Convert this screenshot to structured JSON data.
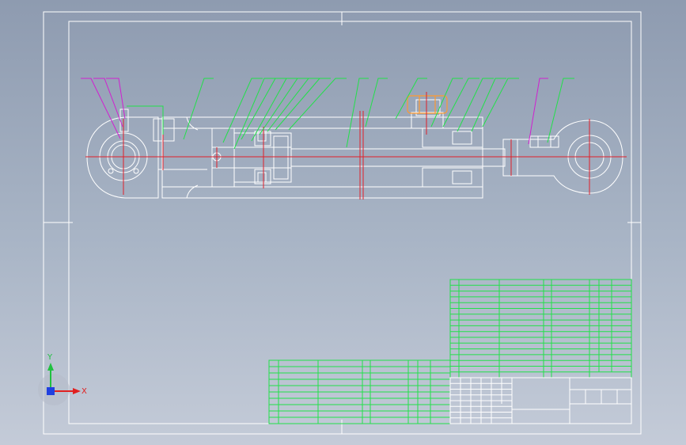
{
  "viewport": {
    "background_top": "#8e9bb0",
    "background_bottom": "#c4cbd8"
  },
  "colors": {
    "outline": "#ffffff",
    "centerline": "#e0202a",
    "leader_green": "#22e04a",
    "leader_magenta": "#d020d0",
    "highlight_orange": "#ff9a30",
    "table_green": "#22e04a"
  },
  "ucs": {
    "x_label": "X",
    "y_label": "Y",
    "x_color": "#e02020",
    "y_color": "#20c040",
    "origin_color": "#2040e0"
  }
}
